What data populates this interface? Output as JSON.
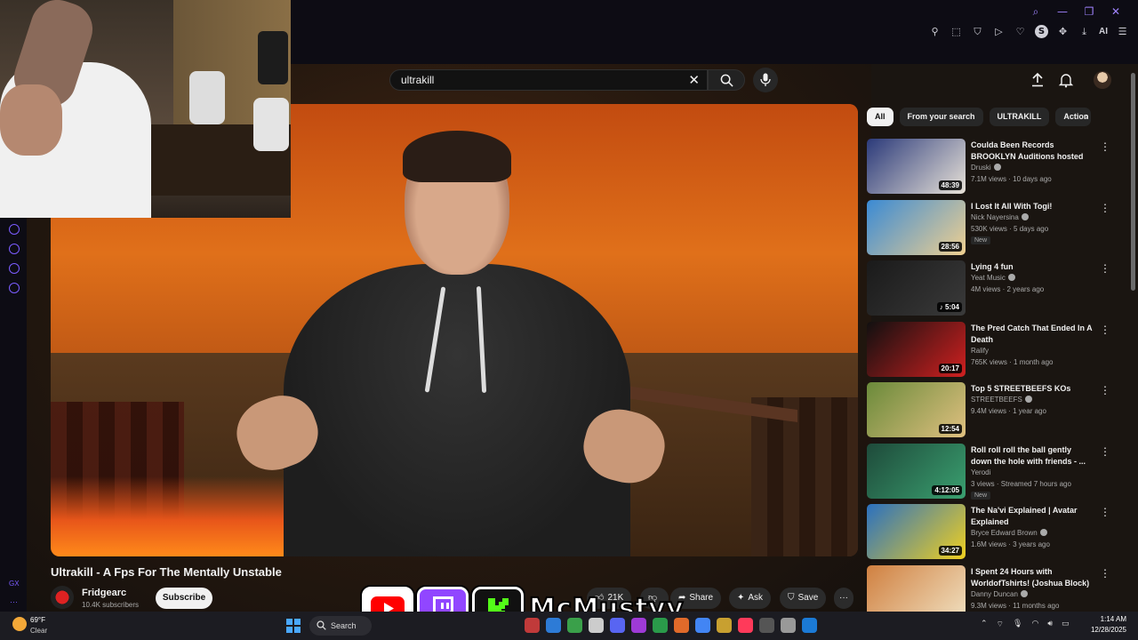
{
  "browser": {
    "window_controls": [
      "search",
      "minimize",
      "maximize",
      "close"
    ],
    "extensions": [
      "pin-icon",
      "screenshot-icon",
      "shield-icon",
      "play-icon",
      "heart-icon",
      "S",
      "puzzle-icon",
      "download-icon",
      "ai-icon",
      "menu-icon"
    ],
    "ai_label": "AI",
    "gx_label": "GX",
    "gx_dots": "···"
  },
  "search": {
    "query": "ultrakill",
    "clear_icon": "close-icon",
    "search_icon": "search-icon",
    "mic_icon": "mic-icon"
  },
  "video": {
    "title": "Ultrakill - A Fps For The Mentally Unstable",
    "channel": "Fridgearc",
    "subscribers": "10.4K subscribers",
    "subscribe_label": "Subscribe",
    "likes": "21K",
    "share_label": "Share",
    "ask_label": "Ask",
    "save_label": "Save",
    "more_label": "···"
  },
  "chips": [
    "All",
    "From your search",
    "ULTRAKILL",
    "Action"
  ],
  "recommendations": [
    {
      "title": "Coulda Been Records BROOKLYN Auditions hosted b...",
      "channel": "Druski",
      "verified": true,
      "meta": "7.1M views · 10 days ago",
      "duration": "48:39",
      "badge": "",
      "thumb_colors": [
        "#2b3a7a",
        "#e8e2d8"
      ]
    },
    {
      "title": "I Lost It All With Togi!",
      "channel": "Nick Nayersina",
      "verified": true,
      "meta": "530K views · 5 days ago",
      "duration": "28:56",
      "badge": "New",
      "thumb_colors": [
        "#3a8ad4",
        "#f0d090"
      ]
    },
    {
      "title": "Lying 4 fun",
      "channel": "Yeat Music",
      "verified": true,
      "meta": "4M views · 2 years ago",
      "duration": "♪ 5:04",
      "badge": "",
      "thumb_colors": [
        "#1a1a1a",
        "#3a3a3a"
      ]
    },
    {
      "title": "The Pred Catch That Ended In A Death",
      "channel": "Ralify",
      "verified": false,
      "meta": "765K views · 1 month ago",
      "duration": "20:17",
      "badge": "",
      "thumb_colors": [
        "#101010",
        "#d02020"
      ]
    },
    {
      "title": "Top 5 STREETBEEFS KOs",
      "channel": "STREETBEEFS",
      "verified": true,
      "meta": "9.4M views · 1 year ago",
      "duration": "12:54",
      "badge": "",
      "thumb_colors": [
        "#6a8a3a",
        "#e0c080"
      ]
    },
    {
      "title": "Roll roll roll the ball gently down the hole with friends - ...",
      "channel": "Yerodi",
      "verified": false,
      "meta": "3 views · Streamed 7 hours ago",
      "duration": "4:12:05",
      "badge": "New",
      "thumb_colors": [
        "#1e4a3a",
        "#3aa070"
      ]
    },
    {
      "title": "The Na'vi Explained | Avatar Explained",
      "channel": "Bryce Edward Brown",
      "verified": true,
      "meta": "1.6M views · 3 years ago",
      "duration": "34:27",
      "badge": "",
      "thumb_colors": [
        "#2a70c0",
        "#f0d020"
      ]
    },
    {
      "title": "I Spent 24 Hours with WorldofTshirts! (Joshua Block)",
      "channel": "Danny Duncan",
      "verified": true,
      "meta": "9.3M views · 11 months ago",
      "duration": "",
      "badge": "",
      "thumb_colors": [
        "#d08040",
        "#f0e0c0"
      ]
    }
  ],
  "overlay": {
    "streamer_name": "McMustyy",
    "platforms": [
      "youtube-logo",
      "twitch-logo",
      "kick-logo"
    ],
    "kick_letter": "K"
  },
  "taskbar": {
    "temperature": "69°F",
    "condition": "Clear",
    "search_label": "Search",
    "time": "1:14 AM",
    "date": "12/28/2025",
    "apps": [
      "#c03a3a",
      "#2d7bd6",
      "#3aa04a",
      "#ccc",
      "#5865f2",
      "#9e3ad6",
      "#2a9a4a",
      "#e06a2a",
      "#4285f4",
      "#c8a030",
      "#ff3a5a",
      "#555",
      "#999",
      "#1b7ad6"
    ]
  }
}
